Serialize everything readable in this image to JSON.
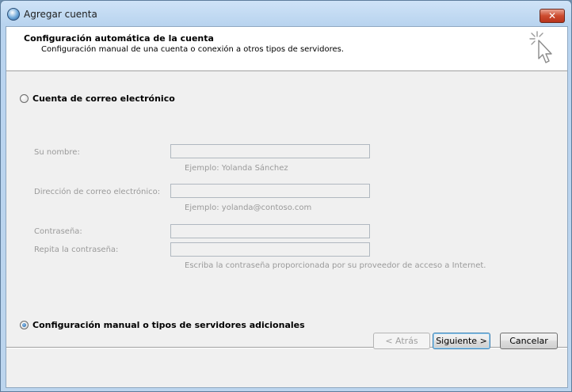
{
  "window": {
    "title": "Agregar cuenta",
    "close_glyph": "✕"
  },
  "header": {
    "title": "Configuración automática de la cuenta",
    "subtitle": "Configuración manual de una cuenta o conexión a otros tipos de servidores."
  },
  "options": {
    "email_account": {
      "label": "Cuenta de correo electrónico",
      "selected": false
    },
    "manual_config": {
      "label": "Configuración manual o tipos de servidores adicionales",
      "selected": true
    }
  },
  "form": {
    "name": {
      "label": "Su nombre:",
      "value": "",
      "hint": "Ejemplo: Yolanda Sánchez"
    },
    "email": {
      "label": "Dirección de correo electrónico:",
      "value": "",
      "hint": "Ejemplo: yolanda@contoso.com"
    },
    "password": {
      "label": "Contraseña:",
      "value": ""
    },
    "password_repeat": {
      "label": "Repita la contraseña:",
      "value": "",
      "hint": "Escriba la contraseña proporcionada por su proveedor de acceso a Internet."
    }
  },
  "buttons": {
    "back": "< Atrás",
    "next": "Siguiente >",
    "cancel": "Cancelar"
  },
  "icons": {
    "app": "outlook-icon",
    "wizard": "cursor-sparkle-icon"
  }
}
